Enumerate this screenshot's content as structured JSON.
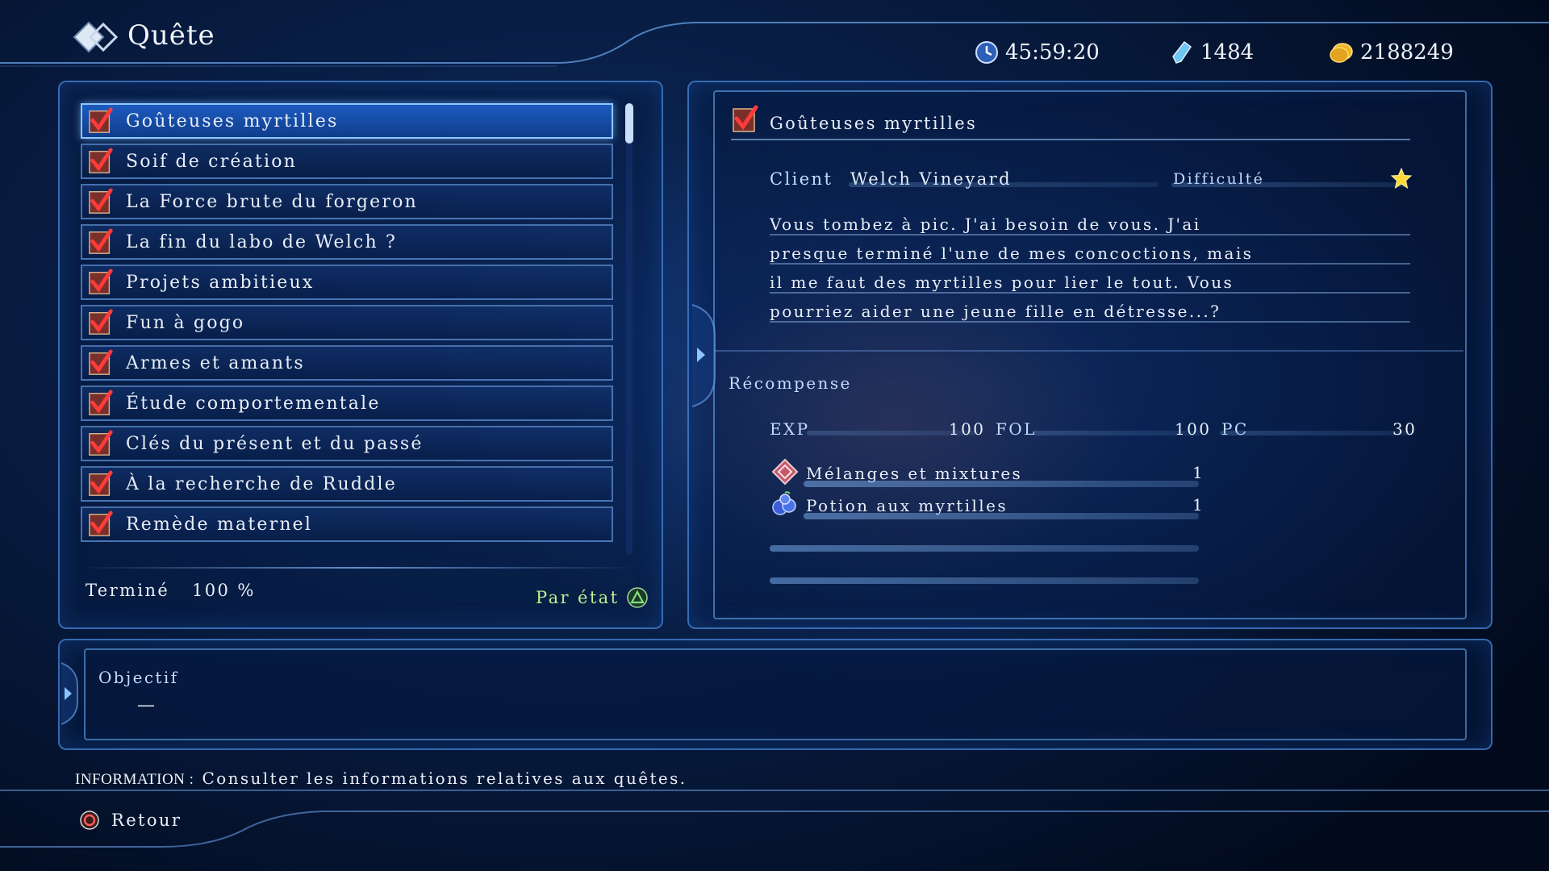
{
  "header": {
    "title": "Quête"
  },
  "stats": {
    "time": "45:59:20",
    "crystals": "1484",
    "gold": "2188249"
  },
  "quests": [
    {
      "label": "Goûteuses myrtilles",
      "selected": true
    },
    {
      "label": "Soif de création"
    },
    {
      "label": "La Force brute du forgeron"
    },
    {
      "label": "La fin du labo de Welch ?"
    },
    {
      "label": "Projets ambitieux"
    },
    {
      "label": "Fun à gogo"
    },
    {
      "label": "Armes et amants"
    },
    {
      "label": "Étude comportementale"
    },
    {
      "label": "Clés du présent et du passé"
    },
    {
      "label": "À la recherche de Ruddle"
    },
    {
      "label": "Remède maternel"
    }
  ],
  "list_footer": {
    "completed_label": "Terminé",
    "completed_value": "100 %",
    "sort_label": "Par état"
  },
  "detail": {
    "title": "Goûteuses myrtilles",
    "client_label": "Client",
    "client_value": "Welch Vineyard",
    "difficulty_label": "Difficulté",
    "difficulty_stars": 1,
    "description_lines": [
      "Vous tombez à pic. J'ai besoin de vous. J'ai",
      "presque terminé l'une de mes concoctions, mais",
      "il me faut des myrtilles pour lier le tout. Vous",
      "pourriez aider une jeune fille en détresse...?"
    ],
    "reward_label": "Récompense",
    "exp_label": "EXP",
    "exp_value": "100",
    "fol_label": "FOL",
    "fol_value": "100",
    "pc_label": "PC",
    "pc_value": "30",
    "items": [
      {
        "name": "Mélanges et mixtures",
        "qty": "1",
        "icon": "recipe-book-icon"
      },
      {
        "name": "Potion aux myrtilles",
        "qty": "1",
        "icon": "berry-potion-icon"
      }
    ]
  },
  "objective": {
    "label": "Objectif",
    "value": "—"
  },
  "info": {
    "prefix": "INFORMATION :",
    "text": "Consulter les informations relatives aux quêtes."
  },
  "footer": {
    "back_label": "Retour"
  },
  "colors": {
    "accent": "#1d5bc0",
    "frame": "#6fb0ff",
    "check_red": "#e0303a",
    "sort_green": "#b9f08c"
  }
}
